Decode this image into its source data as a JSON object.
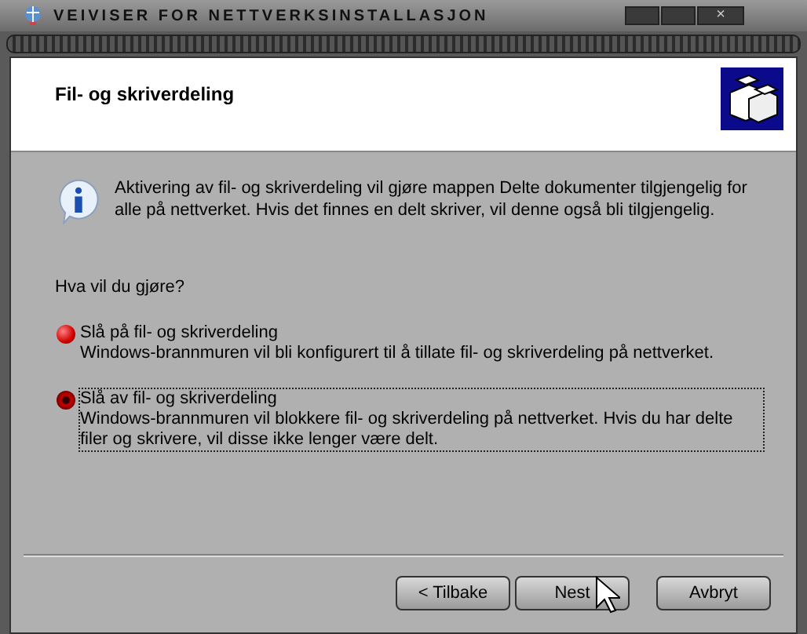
{
  "window": {
    "title": "VEIVISER FOR NETTVERKSINSTALLASJON",
    "controls": [
      "×"
    ]
  },
  "header": {
    "title": "Fil- og skriverdeling"
  },
  "info": {
    "text": "Aktivering av fil- og skriverdeling vil gjøre mappen Delte dokumenter tilgjengelig for alle på nettverket. Hvis det finnes en delt skriver, vil denne også bli tilgjengelig."
  },
  "question": "Hva vil du gjøre?",
  "options": [
    {
      "label": "Slå på fil- og skriverdeling",
      "description": "Windows-brannmuren vil bli konfigurert til å tillate fil- og skriverdeling på nettverket.",
      "selected": false
    },
    {
      "label": "Slå av fil- og skriverdeling",
      "description": "Windows-brannmuren vil blokkere fil- og skriverdeling på nettverket. Hvis du har delte filer og skrivere, vil disse ikke lenger være delt.",
      "selected": true
    }
  ],
  "buttons": [
    "< Tilbake",
    "Nest",
    "Avbryt"
  ]
}
